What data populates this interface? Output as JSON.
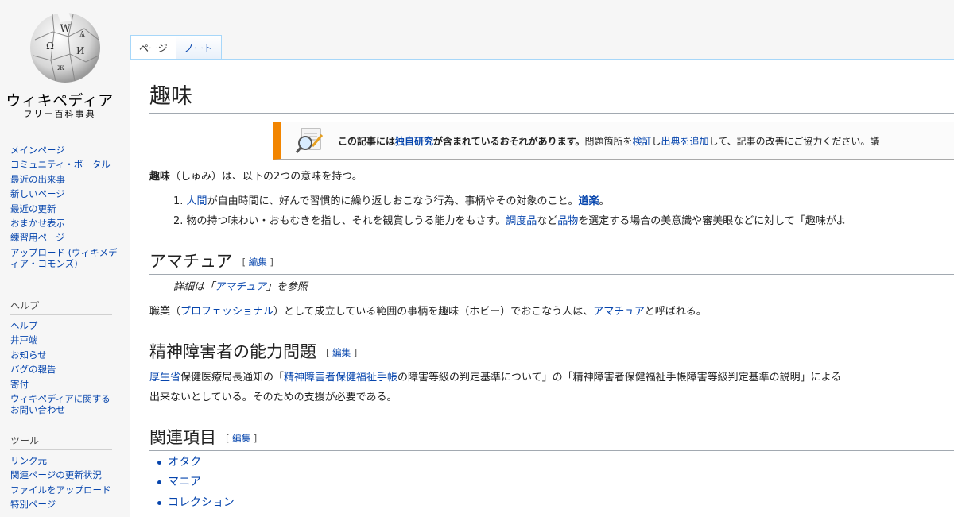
{
  "logo": {
    "title": "ウィキペディア",
    "subtitle": "フリー百科事典"
  },
  "sidebar": {
    "nav": [
      "メインページ",
      "コミュニティ・ポータル",
      "最近の出来事",
      "新しいページ",
      "最近の更新",
      "おまかせ表示",
      "練習用ページ",
      "アップロード (ウィキメディア・コモンズ)"
    ],
    "help_heading": "ヘルプ",
    "help": [
      "ヘルプ",
      "井戸端",
      "お知らせ",
      "バグの報告",
      "寄付",
      "ウィキペディアに関するお問い合わせ"
    ],
    "tools_heading": "ツール",
    "tools": [
      "リンク元",
      "関連ページの更新状況",
      "ファイルをアップロード",
      "特別ページ"
    ]
  },
  "tabs": {
    "page": "ページ",
    "talk": "ノート"
  },
  "article": {
    "title": "趣味",
    "ambox": {
      "bold1": "この記事には",
      "link1": "独自研究",
      "bold2": "が含まれているおそれがあります。",
      "t1": "問題箇所を",
      "link2": "検証",
      "t2": "し",
      "link3": "出典を追加",
      "t3": "して、記事の改善にご協力ください。議"
    },
    "intro": {
      "bold": "趣味",
      "rest": "（しゅみ）は、以下の2つの意味を持つ。"
    },
    "list": [
      {
        "num": "1.",
        "link1": "人間",
        "t1": "が自由時間に、好んで習慣的に繰り返しおこなう行為、事柄やその対象のこと。",
        "link2": "道楽",
        "t2": "。"
      },
      {
        "num": "2.",
        "t0": "物の持つ味わい・おもむきを指し、それを観賞しうる能力をもさす。",
        "link1": "調度品",
        "t1": "など",
        "link2": "品物",
        "t2": "を選定する場合の美意識や審美眼などに対して「趣味がよ"
      }
    ],
    "edit_label": "編集",
    "sec_amateur": {
      "title": "アマチュア",
      "hat_pre": "詳細は「",
      "hat_link": "アマチュア",
      "hat_post": "」を参照",
      "p_t1": "職業（",
      "p_link1": "プロフェッショナル",
      "p_t2": "）として成立している範囲の事柄を趣味（ホビー）でおこなう人は、",
      "p_link2": "アマチュア",
      "p_t3": "と呼ばれる。"
    },
    "sec_disability": {
      "title": "精神障害者の能力問題",
      "link1": "厚生省",
      "t1": "保健医療局長通知の「",
      "link2": "精神障害者保健福祉手帳",
      "t2": "の障害等級の判定基準について」の「精神障害者保健福祉手帳障害等級判定基準の説明」による",
      "line2": "出来ないとしている。そのための支援が必要である。"
    },
    "sec_related": {
      "title": "関連項目",
      "items": [
        "オタク",
        "マニア",
        "コレクション"
      ]
    }
  }
}
